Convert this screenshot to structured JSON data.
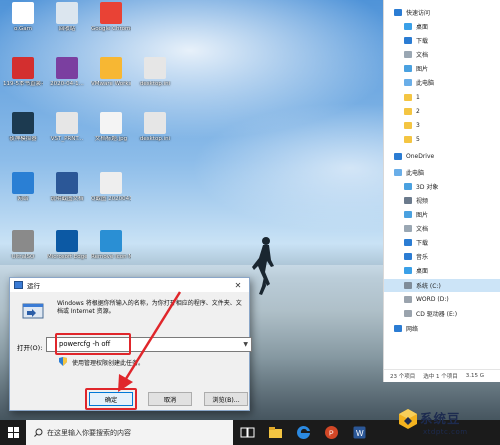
{
  "desktop_icons": [
    {
      "label": "o.Gam",
      "color": "#ffffff"
    },
    {
      "label": "回收站",
      "color": "#dce6ef"
    },
    {
      "label": "Google Chrome",
      "color": "#e94235"
    },
    {
      "label": "119-5本书直装+模板",
      "color": "#d32f2f"
    },
    {
      "label": "2020-04-1...",
      "color": "#7b3fa0"
    },
    {
      "label": "VMware Workstation",
      "color": "#f7b733"
    },
    {
      "label": "desktop.ini",
      "color": "#e6e6e6"
    },
    {
      "label": "夜神模拟器",
      "color": "#1c3a50"
    },
    {
      "label": "VST_PRNT...",
      "color": "#e6e6e6"
    },
    {
      "label": "文档标题.jpg",
      "color": "#f4f4f4"
    },
    {
      "label": "desktop.ini",
      "color": "#e6e6e6"
    },
    {
      "label": "网络",
      "color": "#2a7fd4"
    },
    {
      "label": "说明截图文档",
      "color": "#2b5797"
    },
    {
      "label": "Q截图 20200415...",
      "color": "#eeeeee"
    },
    {
      "label": "UltraISO",
      "color": "#8a8a8a"
    },
    {
      "label": "Microsoft Edge",
      "color": "#0c59a4"
    },
    {
      "label": "Remove Icon Now",
      "color": "#2a8fd4"
    }
  ],
  "explorer": {
    "nav_items": [
      {
        "label": "快速访问",
        "icon": "star-icon",
        "color": "#2b7cd3"
      },
      {
        "label": "桌面",
        "icon": "desktop-icon",
        "color": "#3aa0e8"
      },
      {
        "label": "下载",
        "icon": "download-icon",
        "color": "#2b7cd3"
      },
      {
        "label": "文档",
        "icon": "document-icon",
        "color": "#9aa7b3"
      },
      {
        "label": "图片",
        "icon": "picture-icon",
        "color": "#4aa1e0"
      },
      {
        "label": "此电脑",
        "icon": "computer-icon",
        "color": "#6aaee8"
      },
      {
        "label": "1",
        "icon": "folder-icon",
        "color": "#f4c542"
      },
      {
        "label": "2",
        "icon": "folder-icon",
        "color": "#f4c542"
      },
      {
        "label": "3",
        "icon": "folder-icon",
        "color": "#f4c542"
      },
      {
        "label": "5",
        "icon": "folder-icon",
        "color": "#f4c542"
      },
      {
        "label": "OneDrive",
        "icon": "cloud-icon",
        "color": "#2b7cd3"
      },
      {
        "label": "此电脑",
        "icon": "computer-icon",
        "color": "#6aaee8"
      },
      {
        "label": "3D 对象",
        "icon": "cube-icon",
        "color": "#4aa1e0"
      },
      {
        "label": "视频",
        "icon": "video-icon",
        "color": "#6b7a8c"
      },
      {
        "label": "图片",
        "icon": "picture-icon",
        "color": "#4aa1e0"
      },
      {
        "label": "文档",
        "icon": "document-icon",
        "color": "#9aa7b3"
      },
      {
        "label": "下载",
        "icon": "download-icon",
        "color": "#2b7cd3"
      },
      {
        "label": "音乐",
        "icon": "music-icon",
        "color": "#2b7cd3"
      },
      {
        "label": "桌面",
        "icon": "desktop-icon",
        "color": "#3aa0e8"
      },
      {
        "label": "系统 (C:)",
        "icon": "drive-icon",
        "color": "#7f8c99"
      },
      {
        "label": "WORD (D:)",
        "icon": "drive-icon",
        "color": "#9aa3ad"
      },
      {
        "label": "CD 驱动器 (E:)",
        "icon": "cd-drive-icon",
        "color": "#9aa3ad"
      },
      {
        "label": "网络",
        "icon": "network-icon",
        "color": "#2b7cd3"
      }
    ],
    "status": {
      "count": "23 个项目",
      "selection": "选中 1 个项目",
      "size": "3.15 G"
    }
  },
  "run_dialog": {
    "title": "运行",
    "close": "✕",
    "description": "Windows 将根据你所输入的名称，为你打开相应的程序、文件夹、文档或 Internet 资源。",
    "open_label": "打开(O):",
    "command_value": "powercfg -h off",
    "admin_note": "使用管理权限创建此任务。",
    "buttons": {
      "ok": "确定",
      "cancel": "取消",
      "browse": "浏览(B)..."
    }
  },
  "taskbar": {
    "search_placeholder": "在这里输入你要搜索的内容"
  },
  "watermark": {
    "brand": "系统豆",
    "url": "xtdptc.com"
  },
  "colors": {
    "highlight_red": "#e0262b",
    "selected_nav": "#cce4f7",
    "taskbar": "#1b1b1b"
  }
}
